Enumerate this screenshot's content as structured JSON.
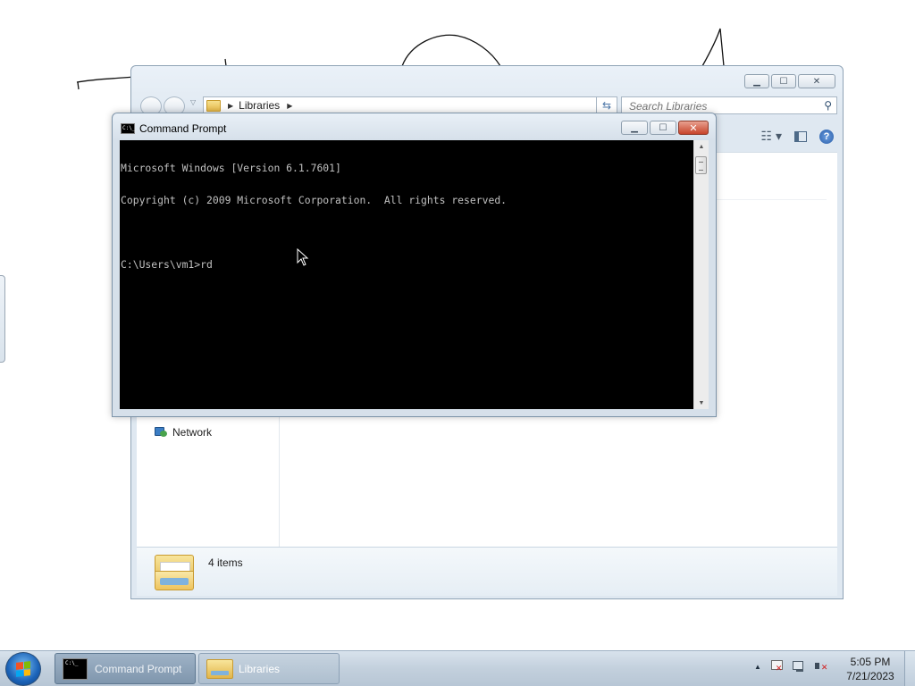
{
  "explorer": {
    "breadcrumb": "Libraries",
    "search_placeholder": "Search Libraries",
    "nav_network": "Network",
    "items_count": "4 items",
    "window_controls": {
      "minimize": "▁",
      "maximize": "☐",
      "close": "✕"
    }
  },
  "cmd": {
    "title": "Command Prompt",
    "icon_text": "C:\\_",
    "lines": [
      "Microsoft Windows [Version 6.1.7601]",
      "Copyright (c) 2009 Microsoft Corporation.  All rights reserved.",
      "",
      "C:\\Users\\vm1>rd"
    ],
    "window_controls": {
      "minimize": "▁",
      "maximize": "☐",
      "close": "✕"
    }
  },
  "taskbar": {
    "buttons": [
      {
        "label": "Command Prompt",
        "icon": "command-prompt-icon",
        "active": true
      },
      {
        "label": "Libraries",
        "icon": "libraries-folder-icon",
        "active": false
      }
    ],
    "clock": {
      "time": "5:05 PM",
      "date": "7/21/2023"
    },
    "tray_icons": [
      "show-hidden-icons",
      "action-center-flag-icon",
      "network-icon",
      "volume-muted-icon"
    ]
  },
  "colors": {
    "console_bg": "#000000",
    "console_fg": "#c0c0c0",
    "close_button": "#c7432a",
    "taskbar": "#c3d0dd"
  }
}
